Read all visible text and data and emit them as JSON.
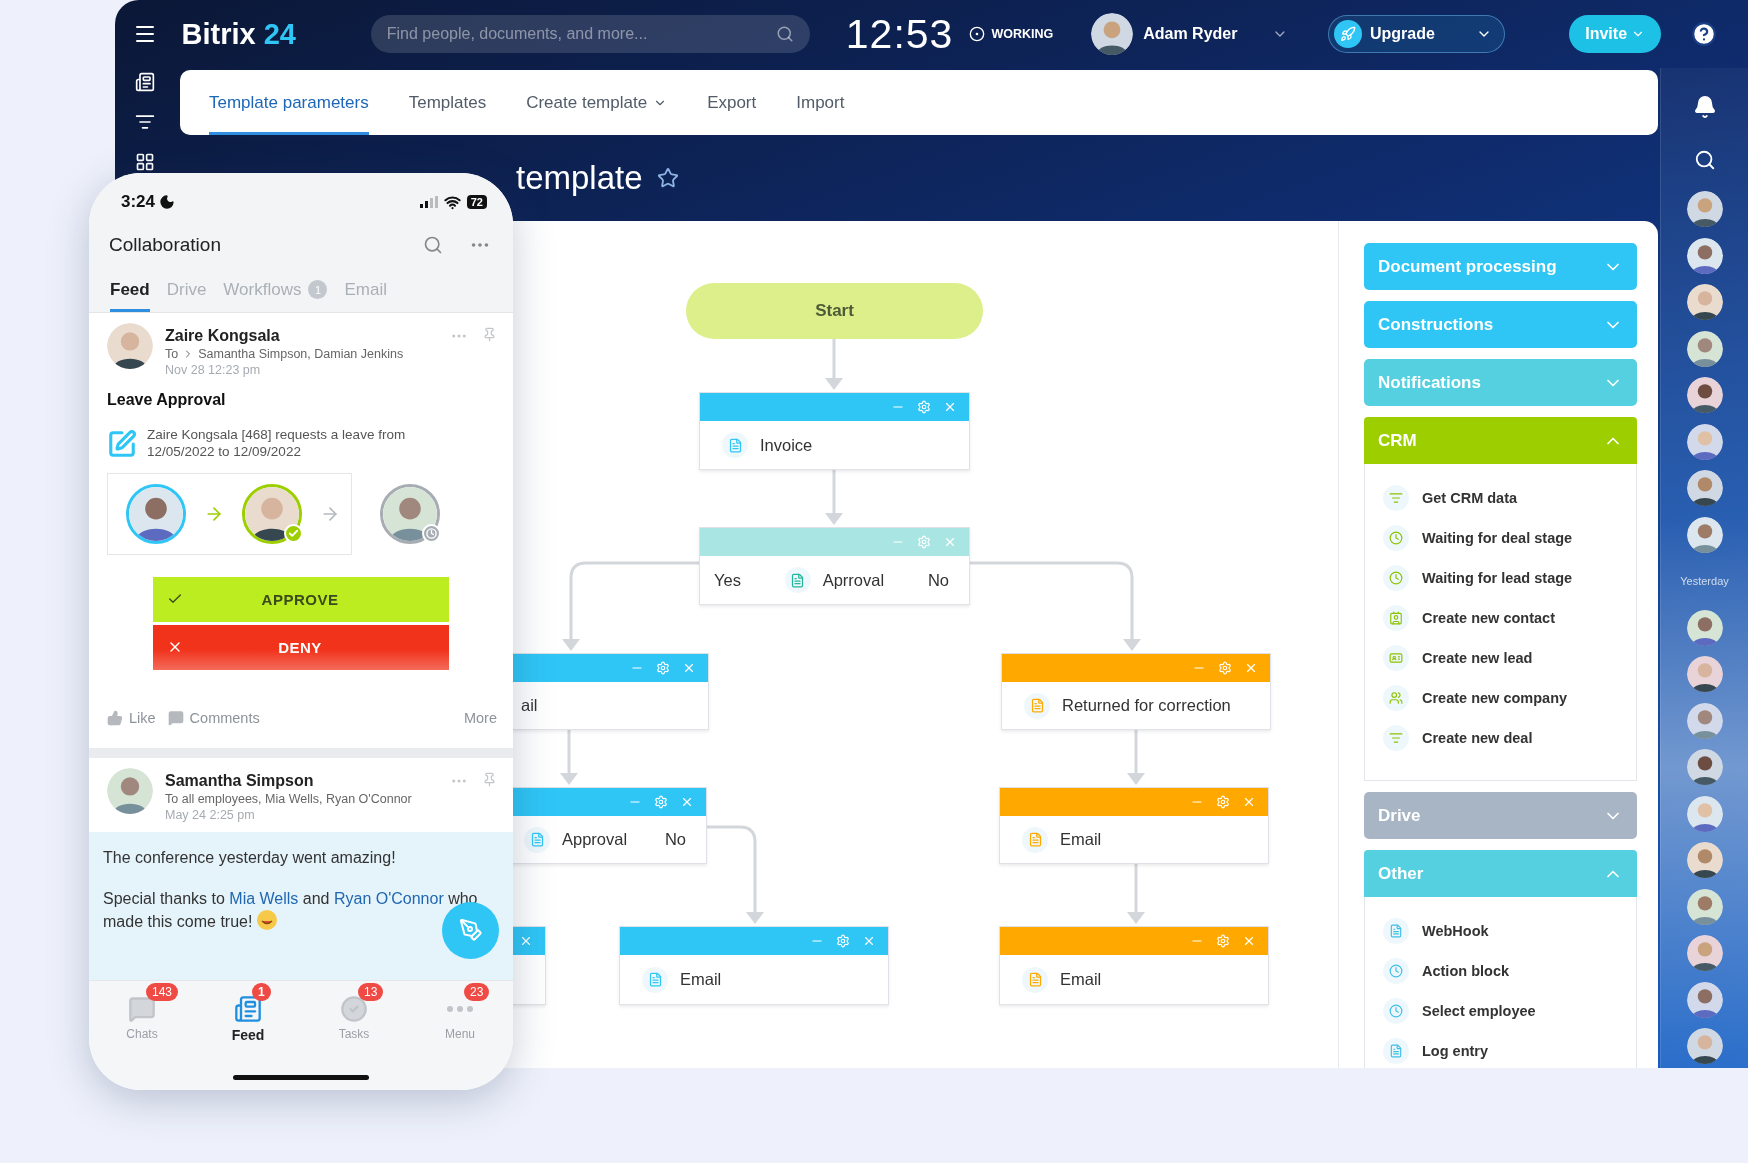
{
  "topbar": {
    "logo_name": "Bitrix",
    "logo_number": "24",
    "search": {
      "placeholder": "Find people, documents, and more..."
    },
    "clock": "12:53",
    "work_status": "WORKING",
    "user": "Adam Ryder",
    "upgrade": "Upgrade",
    "invite": "Invite"
  },
  "tabs": [
    {
      "label": "Template parameters",
      "selected": true,
      "has_menu": false
    },
    {
      "label": "Templates",
      "selected": false,
      "has_menu": false
    },
    {
      "label": "Create template",
      "selected": false,
      "has_menu": true
    },
    {
      "label": "Export",
      "selected": false,
      "has_menu": false
    },
    {
      "label": "Import",
      "selected": false,
      "has_menu": false
    }
  ],
  "page_title": "template",
  "flow": {
    "nodes": [
      {
        "kind": "start",
        "label": "Start"
      },
      {
        "kind": "action",
        "color": "#2fc6f6",
        "label": "Invoice",
        "icon": true
      },
      {
        "kind": "condition",
        "color": "#a9e6e3",
        "label": "Aprroval",
        "icon": true,
        "yes": "Yes",
        "no": "No"
      },
      {
        "kind": "action",
        "color": "#2fc6f6",
        "label": "ail",
        "icon": false
      },
      {
        "kind": "action",
        "color": "#ffa900",
        "label": "Returned for correction",
        "icon": true
      },
      {
        "kind": "condition",
        "color": "#2fc6f6",
        "label": "Approval",
        "icon": true,
        "no": "No"
      },
      {
        "kind": "action",
        "color": "#ffa900",
        "label": "Email",
        "icon": true
      },
      {
        "kind": "action",
        "color": "#2fc6f6"
      },
      {
        "kind": "action",
        "color": "#2fc6f6",
        "label": "Email",
        "icon": true
      },
      {
        "kind": "action",
        "color": "#ffa900",
        "label": "Email",
        "icon": true
      }
    ]
  },
  "toolbox": [
    {
      "title": "Document processing",
      "color": "#2fc6f6",
      "expanded": false
    },
    {
      "title": "Constructions",
      "color": "#2fc6f6",
      "expanded": false
    },
    {
      "title": "Notifications",
      "color": "#55d0e0",
      "expanded": false
    },
    {
      "title": "CRM",
      "color": "#9dcf00",
      "expanded": true,
      "items": [
        {
          "kind": "filter",
          "label": "Get CRM data"
        },
        {
          "kind": "clock",
          "label": "Waiting for deal stage"
        },
        {
          "kind": "clock",
          "label": "Waiting for lead stage"
        },
        {
          "kind": "contact",
          "label": "Create new contact"
        },
        {
          "kind": "card",
          "label": "Create new lead"
        },
        {
          "kind": "people",
          "label": "Create new company"
        },
        {
          "kind": "filter",
          "label": "Create new deal"
        }
      ]
    },
    {
      "title": "Drive",
      "color": "#a8b5c4",
      "expanded": false
    },
    {
      "title": "Other",
      "color": "#55d0e0",
      "expanded": true,
      "items": [
        {
          "kind": "document",
          "label": "WebHook"
        },
        {
          "kind": "clock",
          "label": "Action block"
        },
        {
          "kind": "clock",
          "label": "Select employee"
        },
        {
          "kind": "document",
          "label": "Log entry"
        }
      ]
    }
  ],
  "right_rail": [
    {
      "kind": "avatar"
    },
    {
      "kind": "avatar"
    },
    {
      "kind": "avatar"
    },
    {
      "kind": "avatar"
    },
    {
      "kind": "avatar"
    },
    {
      "kind": "avatar"
    },
    {
      "kind": "avatar"
    },
    {
      "kind": "avatar"
    },
    {
      "kind": "label",
      "text": "Yesterday"
    },
    {
      "kind": "avatar"
    },
    {
      "kind": "avatar"
    },
    {
      "kind": "avatar"
    },
    {
      "kind": "avatar"
    },
    {
      "kind": "avatar"
    },
    {
      "kind": "avatar"
    },
    {
      "kind": "avatar"
    },
    {
      "kind": "avatar"
    },
    {
      "kind": "avatar"
    },
    {
      "kind": "avatar"
    }
  ],
  "phone": {
    "status_time": "3:24",
    "battery": "72",
    "title": "Collaboration",
    "tabs": [
      {
        "label": "Feed",
        "selected": true
      },
      {
        "label": "Drive",
        "selected": false
      },
      {
        "label": "Workflows",
        "selected": false,
        "badge": "1"
      },
      {
        "label": "Email",
        "selected": false
      }
    ],
    "posts": [
      {
        "kind": "approval",
        "author": "Zaire Kongsala",
        "to_prefix": "To",
        "recipients": "Samantha Simpson, Damian Jenkins",
        "time": "Nov 28 12:23 pm",
        "title": "Leave Approval",
        "request": "Zaire Kongsala [468] requests a leave from 12/05/2022 to 12/09/2022",
        "chain": [
          {
            "kind": "author"
          },
          {
            "kind": "approved"
          },
          {
            "kind": "waiting"
          }
        ],
        "approve": "APPROVE",
        "deny": "DENY",
        "like": "Like",
        "comments": "Comments",
        "more": "More"
      },
      {
        "kind": "message",
        "author": "Samantha Simpson",
        "recipients": "To all employees, Mia Wells, Ryan O'Connor",
        "time": "May 24 2:25 pm",
        "paragraphs": [
          [
            {
              "kind": "text",
              "text": "The conference yesterday went amazing!"
            }
          ],
          [
            {
              "kind": "text",
              "text": "Special thanks to "
            },
            {
              "kind": "link",
              "text": "Mia Wells"
            },
            {
              "kind": "text",
              "text": " and "
            },
            {
              "kind": "link",
              "text": "Ryan O'Connor"
            },
            {
              "kind": "text",
              "text": " who made this come true! "
            },
            {
              "kind": "emoji"
            }
          ]
        ]
      }
    ],
    "nav": [
      {
        "kind": "chats",
        "label": "Chats",
        "badge": "143",
        "selected": false
      },
      {
        "kind": "feed",
        "label": "Feed",
        "badge": "1",
        "selected": true
      },
      {
        "kind": "tasks",
        "label": "Tasks",
        "badge": "13",
        "selected": false
      },
      {
        "kind": "menu",
        "label": "Menu",
        "badge": "23",
        "selected": false
      }
    ]
  }
}
